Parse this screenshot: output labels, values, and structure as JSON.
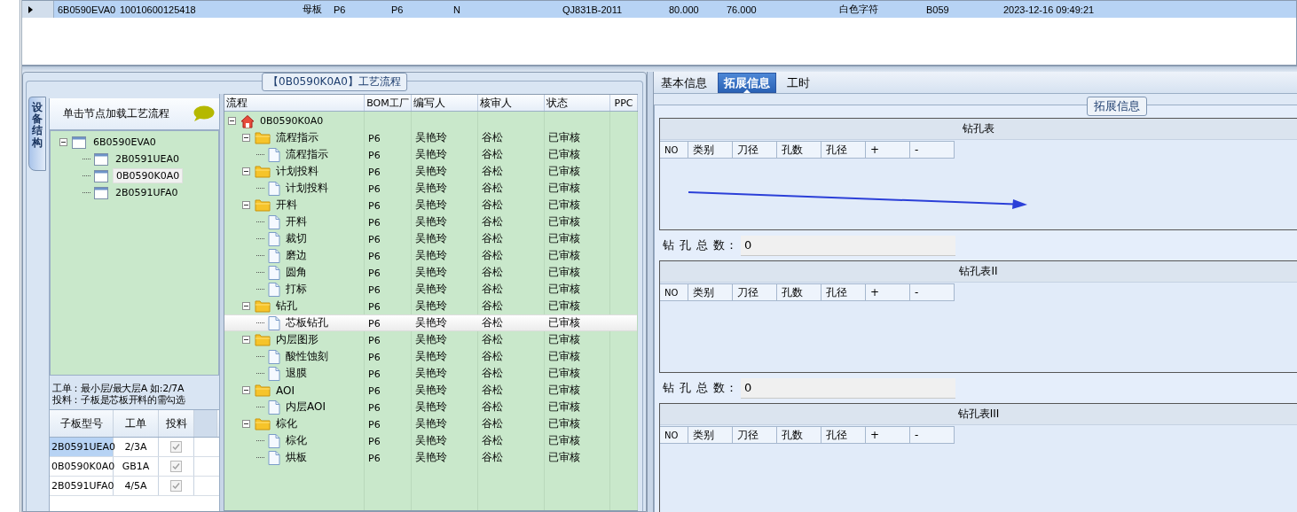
{
  "data_grid": {
    "rows": [
      {
        "selected": true,
        "cells": [
          "6B0590EVA0",
          "10010600125418",
          "母板",
          "P6",
          "P6",
          "N",
          "QJ831B-2011",
          "80.000",
          "76.000",
          "白色字符",
          "B059",
          "2023-12-16 09:49:21"
        ]
      }
    ]
  },
  "process_panel": {
    "title": "【0B0590K0A0】工艺流程",
    "side_tab": {
      "label": "设备结构",
      "selected": true
    },
    "structure_header": "单击节点加载工艺流程",
    "structure_tree": [
      {
        "label": "6B0590EVA0",
        "expanded": true,
        "selected": false,
        "children": [
          {
            "label": "2B0591UEA0",
            "selected": false
          },
          {
            "label": "0B0590K0A0",
            "selected": true
          },
          {
            "label": "2B0591UFA0",
            "selected": false
          }
        ]
      }
    ],
    "notes": [
      "工单：最小层/最大层A 如:2/7A",
      "投料：子板是芯板开料的需勾选"
    ],
    "sub_boards": {
      "columns": [
        "子板型号",
        "工单",
        "投料"
      ],
      "rows": [
        {
          "cells": [
            "2B0591UEA0",
            "2/3A"
          ],
          "checked": true,
          "selected": true
        },
        {
          "cells": [
            "0B0590K0A0",
            "GB1A"
          ],
          "checked": true,
          "selected": false
        },
        {
          "cells": [
            "2B0591UFA0",
            "4/5A"
          ],
          "checked": true,
          "selected": false
        }
      ]
    },
    "flow_tree": {
      "columns": [
        "流程",
        "BOM工厂",
        "编写人",
        "核审人",
        "状态",
        "PPC"
      ],
      "nodes": [
        {
          "kind": "root",
          "label": "0B0590K0A0",
          "expanded": true,
          "selected": false,
          "children": [
            {
              "kind": "group",
              "label": "流程指示",
              "cells": [
                "P6",
                "吴艳玲",
                "谷松",
                "已审核"
              ],
              "expanded": true,
              "selected": false,
              "children": [
                {
                  "kind": "step",
                  "label": "流程指示",
                  "cells": [
                    "P6",
                    "吴艳玲",
                    "谷松",
                    "已审核"
                  ],
                  "selected": false
                }
              ]
            },
            {
              "kind": "group",
              "label": "计划投料",
              "cells": [
                "P6",
                "吴艳玲",
                "谷松",
                "已审核"
              ],
              "expanded": true,
              "selected": false,
              "children": [
                {
                  "kind": "step",
                  "label": "计划投料",
                  "cells": [
                    "P6",
                    "吴艳玲",
                    "谷松",
                    "已审核"
                  ],
                  "selected": false
                }
              ]
            },
            {
              "kind": "group",
              "label": "开料",
              "cells": [
                "P6",
                "吴艳玲",
                "谷松",
                "已审核"
              ],
              "expanded": true,
              "selected": false,
              "children": [
                {
                  "kind": "step",
                  "label": "开料",
                  "cells": [
                    "P6",
                    "吴艳玲",
                    "谷松",
                    "已审核"
                  ],
                  "selected": false
                },
                {
                  "kind": "step",
                  "label": "裁切",
                  "cells": [
                    "P6",
                    "吴艳玲",
                    "谷松",
                    "已审核"
                  ],
                  "selected": false
                },
                {
                  "kind": "step",
                  "label": "磨边",
                  "cells": [
                    "P6",
                    "吴艳玲",
                    "谷松",
                    "已审核"
                  ],
                  "selected": false
                },
                {
                  "kind": "step",
                  "label": "圆角",
                  "cells": [
                    "P6",
                    "吴艳玲",
                    "谷松",
                    "已审核"
                  ],
                  "selected": false
                },
                {
                  "kind": "step",
                  "label": "打标",
                  "cells": [
                    "P6",
                    "吴艳玲",
                    "谷松",
                    "已审核"
                  ],
                  "selected": false
                }
              ]
            },
            {
              "kind": "group",
              "label": "钻孔",
              "cells": [
                "P6",
                "吴艳玲",
                "谷松",
                "已审核"
              ],
              "expanded": true,
              "selected": false,
              "children": [
                {
                  "kind": "step",
                  "label": "芯板钻孔",
                  "cells": [
                    "P6",
                    "吴艳玲",
                    "谷松",
                    "已审核"
                  ],
                  "selected": true
                }
              ]
            },
            {
              "kind": "group",
              "label": "内层图形",
              "cells": [
                "P6",
                "吴艳玲",
                "谷松",
                "已审核"
              ],
              "expanded": true,
              "selected": false,
              "children": [
                {
                  "kind": "step",
                  "label": "酸性蚀刻",
                  "cells": [
                    "P6",
                    "吴艳玲",
                    "谷松",
                    "已审核"
                  ],
                  "selected": false
                },
                {
                  "kind": "step",
                  "label": "退膜",
                  "cells": [
                    "P6",
                    "吴艳玲",
                    "谷松",
                    "已审核"
                  ],
                  "selected": false
                }
              ]
            },
            {
              "kind": "group",
              "label": "AOI",
              "cells": [
                "P6",
                "吴艳玲",
                "谷松",
                "已审核"
              ],
              "expanded": true,
              "selected": false,
              "children": [
                {
                  "kind": "step",
                  "label": "内层AOI",
                  "cells": [
                    "P6",
                    "吴艳玲",
                    "谷松",
                    "已审核"
                  ],
                  "selected": false
                }
              ]
            },
            {
              "kind": "group",
              "label": "棕化",
              "cells": [
                "P6",
                "吴艳玲",
                "谷松",
                "已审核"
              ],
              "expanded": true,
              "selected": false,
              "children": [
                {
                  "kind": "step",
                  "label": "棕化",
                  "cells": [
                    "P6",
                    "吴艳玲",
                    "谷松",
                    "已审核"
                  ],
                  "selected": false
                },
                {
                  "kind": "step",
                  "label": "烘板",
                  "cells": [
                    "P6",
                    "吴艳玲",
                    "谷松",
                    "已审核"
                  ],
                  "selected": false
                }
              ]
            }
          ]
        }
      ]
    }
  },
  "detail_panel": {
    "tabs": [
      {
        "label": "基本信息",
        "selected": false
      },
      {
        "label": "拓展信息",
        "selected": true
      },
      {
        "label": "工时",
        "selected": false
      }
    ],
    "group_title": "拓展信息",
    "drill_tables": [
      {
        "title": "钻孔表",
        "columns": [
          "NO",
          "类别",
          "刀径",
          "孔数",
          "孔径",
          "+",
          "-"
        ],
        "total_label": "钻 孔 总 数：",
        "total_value": "0"
      },
      {
        "title": "钻孔表II",
        "columns": [
          "NO",
          "类别",
          "刀径",
          "孔数",
          "孔径",
          "+",
          "-"
        ],
        "total_label": "钻 孔 总 数：",
        "total_value": "0"
      },
      {
        "title": "钻孔表III",
        "columns": [
          "NO",
          "类别",
          "刀径",
          "孔数",
          "孔径",
          "+",
          "-"
        ]
      }
    ]
  }
}
